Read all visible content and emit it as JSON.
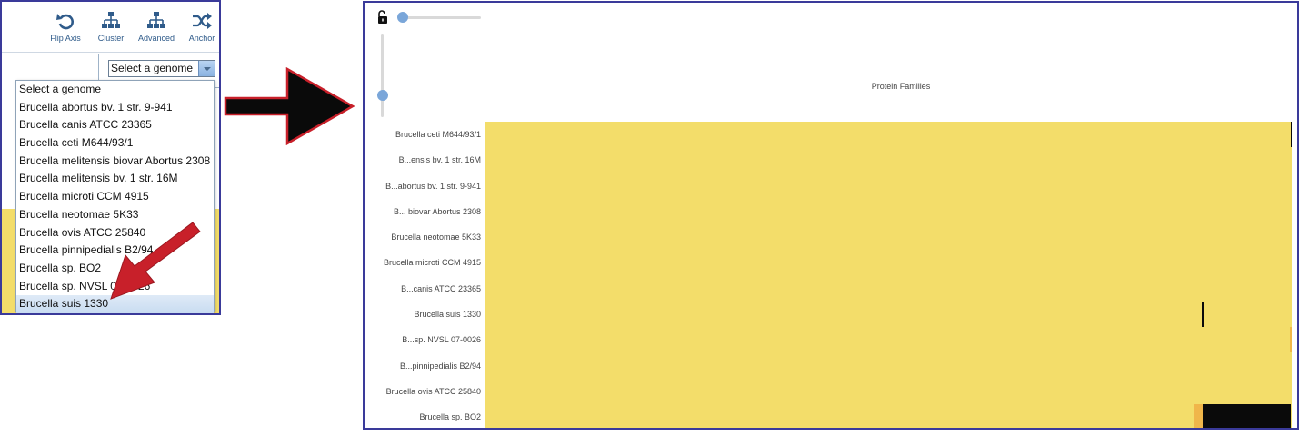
{
  "toolbar": {
    "items": [
      {
        "label": "Flip Axis",
        "icon": "undo-arrow-icon"
      },
      {
        "label": "Cluster",
        "icon": "hierarchy-icon"
      },
      {
        "label": "Advanced",
        "icon": "hierarchy-icon"
      },
      {
        "label": "Anchor",
        "icon": "shuffle-icon"
      }
    ]
  },
  "genome_select": {
    "value": "Select a genome",
    "options": [
      "Select a genome",
      "Brucella abortus bv. 1 str. 9-941",
      "Brucella canis ATCC 23365",
      "Brucella ceti M644/93/1",
      "Brucella melitensis biovar Abortus 2308",
      "Brucella melitensis bv. 1 str. 16M",
      "Brucella microti CCM 4915",
      "Brucella neotomae 5K33",
      "Brucella ovis ATCC 25840",
      "Brucella pinnipedialis B2/94",
      "Brucella sp. BO2",
      "Brucella sp. NVSL 07-0026",
      "Brucella suis 1330"
    ],
    "highlighted": "Brucella suis 1330"
  },
  "heatmap": {
    "x_axis_title": "Protein Families",
    "rows": [
      "Brucella ceti M644/93/1",
      "B...ensis bv. 1 str. 16M",
      "B...abortus bv. 1 str. 9-941",
      "B... biovar Abortus 2308",
      "Brucella neotomae 5K33",
      "Brucella microti CCM 4915",
      "B...canis ATCC 23365",
      "Brucella suis 1330",
      "B...sp. NVSL 07-0026",
      "B...pinnipedialis B2/94",
      "Brucella ovis ATCC 25840",
      "Brucella sp. BO2"
    ]
  },
  "colors": {
    "present": "#f3dd6a",
    "partial": "#f0b64a",
    "absent": "#0a0a0a",
    "slider": "#7aa6d9",
    "annotation_arrow": "#c8202a",
    "panel_border": "#3a3a9a"
  }
}
